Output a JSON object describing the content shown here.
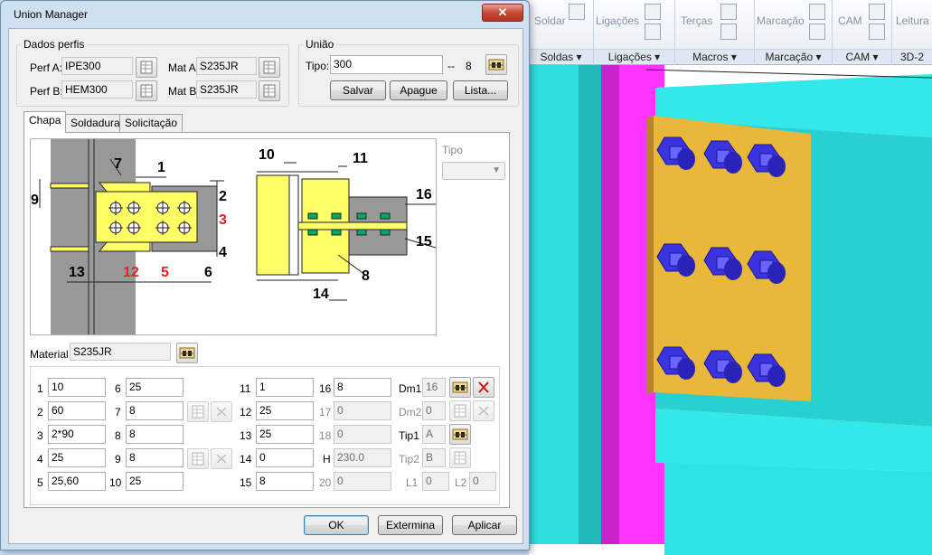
{
  "dialog": {
    "title": "Union Manager",
    "close_glyph": "✕",
    "dados_perfis": {
      "legend": "Dados perfis",
      "perf_a_label": "Perf A:",
      "perf_a_value": "IPE300",
      "perf_b_label": "Perf B:",
      "perf_b_value": "HEM300",
      "mat_a_label": "Mat A:",
      "mat_a_value": "S235JR",
      "mat_b_label": "Mat B:",
      "mat_b_value": "S235JR"
    },
    "uniao": {
      "legend": "União",
      "tipo_label": "Tipo:",
      "tipo_value": "300",
      "separator": "--",
      "number": "8",
      "salvar": "Salvar",
      "apague": "Apague",
      "lista": "Lista..."
    },
    "tabs": [
      "Chapa",
      "Soldadura",
      "Solicitação"
    ],
    "tipo_label": "Tipo",
    "material_label": "Material",
    "material_value": "S235JR",
    "diagram_labels": {
      "d1": "1",
      "d2": "2",
      "d3": "3",
      "d4": "4",
      "d5": "5",
      "d6": "6",
      "d7": "7",
      "d8": "8",
      "d9": "9",
      "d10": "10",
      "d11": "11",
      "d12": "12",
      "d13": "13",
      "d14": "14",
      "d15": "15",
      "d16": "16"
    },
    "params": {
      "p1": {
        "label": "1",
        "value": "10"
      },
      "p2": {
        "label": "2",
        "value": "60"
      },
      "p3": {
        "label": "3",
        "value": "2*90"
      },
      "p4": {
        "label": "4",
        "value": "25"
      },
      "p5": {
        "label": "5",
        "value": "25,60"
      },
      "p6": {
        "label": "6",
        "value": "25"
      },
      "p7": {
        "label": "7",
        "value": "8"
      },
      "p8": {
        "label": "8",
        "value": "8"
      },
      "p9": {
        "label": "9",
        "value": "8"
      },
      "p10": {
        "label": "10",
        "value": "25"
      },
      "p11": {
        "label": "11",
        "value": "1"
      },
      "p12": {
        "label": "12",
        "value": "25"
      },
      "p13": {
        "label": "13",
        "value": "25"
      },
      "p14": {
        "label": "14",
        "value": "0"
      },
      "p15": {
        "label": "15",
        "value": "8"
      },
      "p16": {
        "label": "16",
        "value": "8"
      },
      "p17": {
        "label": "17",
        "value": "0"
      },
      "p18": {
        "label": "18",
        "value": "0"
      },
      "h": {
        "label": "H",
        "value": "230.0"
      },
      "p20": {
        "label": "20",
        "value": "0"
      },
      "dm1": {
        "label": "Dm1",
        "value": "16"
      },
      "dm2": {
        "label": "Dm2",
        "value": "0"
      },
      "tip1": {
        "label": "Tip1",
        "value": "A"
      },
      "tip2": {
        "label": "Tip2",
        "value": "B"
      },
      "l1": {
        "label": "L1",
        "value": "0"
      },
      "l2": {
        "label": "L2",
        "value": "0"
      }
    },
    "buttons": {
      "ok": "OK",
      "extermina": "Extermina",
      "aplicar": "Aplicar"
    }
  },
  "ribbon": {
    "soldar": "Soldar",
    "ligacoes": "Ligações",
    "tercas": "Terças",
    "marcacao": "Marcação",
    "cam": "CAM",
    "leitura": "Leitura",
    "groups": [
      {
        "label": "Soldas ▾"
      },
      {
        "label": "Ligações ▾"
      },
      {
        "label": "Macros ▾"
      },
      {
        "label": "Marcação ▾"
      },
      {
        "label": "CAM ▾"
      },
      {
        "label": "3D-2"
      }
    ]
  },
  "colors": {
    "plate": "#e9b73a",
    "bolt": "#3a33e0",
    "beam": "#33e8e8",
    "column": "#ff33ff",
    "diagram_yellow": "#ffff66",
    "diagram_gray": "#999999",
    "label_red": "#e0202a"
  },
  "icons": [
    "bolt-assembly-icon",
    "table-grid-icon",
    "cross-icon",
    "delete-x-icon"
  ]
}
